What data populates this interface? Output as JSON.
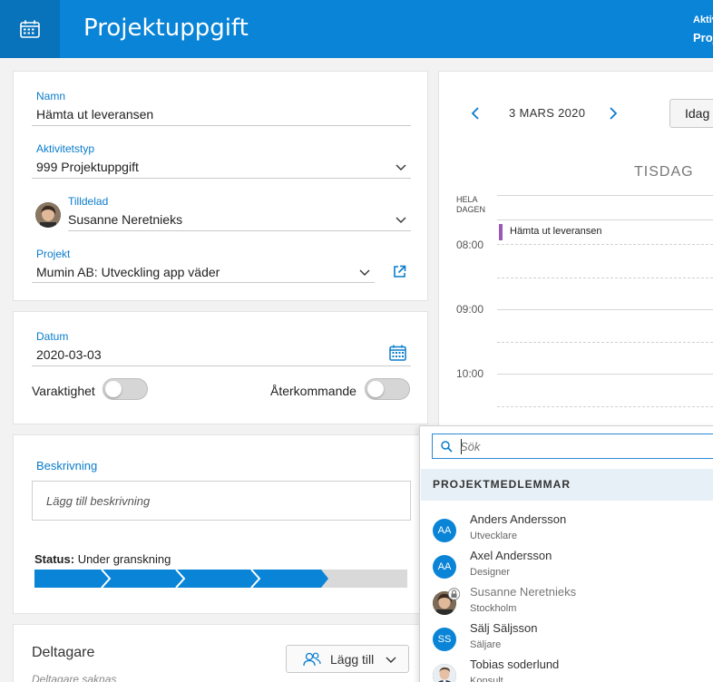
{
  "header": {
    "title": "Projektuppgift",
    "right_top": "Aktiv",
    "right_bottom": "Proj",
    "icon": "calendar-icon"
  },
  "form": {
    "name_label": "Namn",
    "name_value": "Hämta ut leveransen",
    "activity_label": "Aktivitetstyp",
    "activity_value": "999 Projektuppgift",
    "assigned_label": "Tilldelad",
    "assigned_value": "Susanne Neretnieks",
    "project_label": "Projekt",
    "project_value": "Mumin AB: Utveckling app väder",
    "date_label": "Datum",
    "date_value": "2020-03-03",
    "duration_label": "Varaktighet",
    "recurring_label": "Återkommande",
    "description_label": "Beskrivning",
    "description_placeholder": "Lägg till beskrivning",
    "status_label": "Status:",
    "status_value": "Under granskning",
    "status_steps_done": 4,
    "status_steps_total": 5,
    "participants_label": "Deltagare",
    "participants_empty": "Deltagare saknas",
    "add_button_label": "Lägg till"
  },
  "calendar": {
    "date_label": "3 MARS 2020",
    "today_label": "Idag",
    "day_name": "TISDAG",
    "all_day_label_1": "HELA",
    "all_day_label_2": "DAGEN",
    "hours": [
      "08:00",
      "09:00",
      "10:00"
    ],
    "event_title": "Hämta ut leveransen",
    "event_color": "#9b59b6"
  },
  "member_picker": {
    "search_placeholder": "Sök",
    "section_title": "PROJEKTMEDLEMMAR",
    "members": [
      {
        "initials": "AA",
        "name": "Anders Andersson",
        "role": "Utvecklare"
      },
      {
        "initials": "AA",
        "name": "Axel Andersson",
        "role": "Designer"
      },
      {
        "initials": "",
        "name": "Susanne Neretnieks",
        "role": "Stockholm"
      },
      {
        "initials": "SS",
        "name": "Sälj Säljsson",
        "role": "Säljare"
      },
      {
        "initials": "",
        "name": "Tobias soderlund",
        "role": "Konsult"
      }
    ]
  },
  "colors": {
    "accent": "#0a84d6",
    "header_dark": "#0872bb",
    "progress_fill": "#0a84d6",
    "progress_empty": "#d9d9d9"
  }
}
